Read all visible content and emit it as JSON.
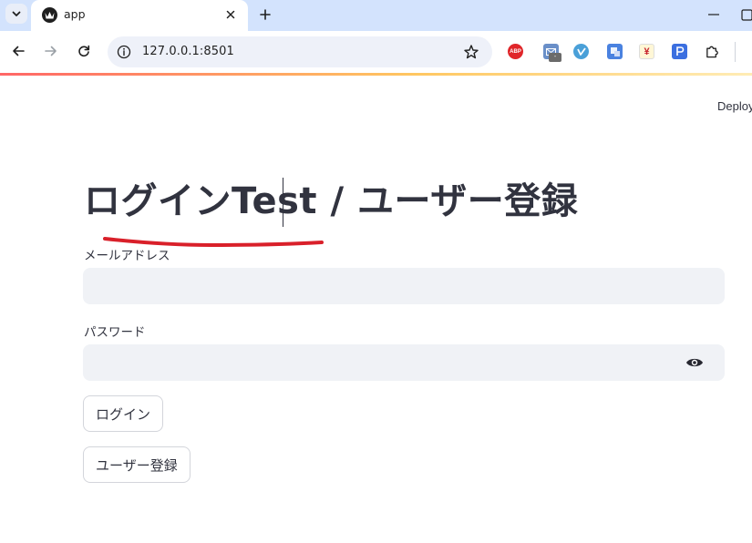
{
  "browser": {
    "tab_title": "app",
    "url": "127.0.0.1:8501",
    "extensions": [
      "ABP",
      "-",
      "¥"
    ]
  },
  "app": {
    "deploy_label": "Deploy",
    "title": "ログインTest / ユーザー登録",
    "email": {
      "label": "メールアドレス",
      "value": "",
      "placeholder": ""
    },
    "password": {
      "label": "パスワード",
      "value": "",
      "placeholder": ""
    },
    "login_button": "ログイン",
    "register_button": "ユーザー登録"
  },
  "colors": {
    "accent": "#ff4b4b",
    "annotation": "#d9202a",
    "text": "#31333f",
    "input_bg": "#f0f2f6"
  }
}
